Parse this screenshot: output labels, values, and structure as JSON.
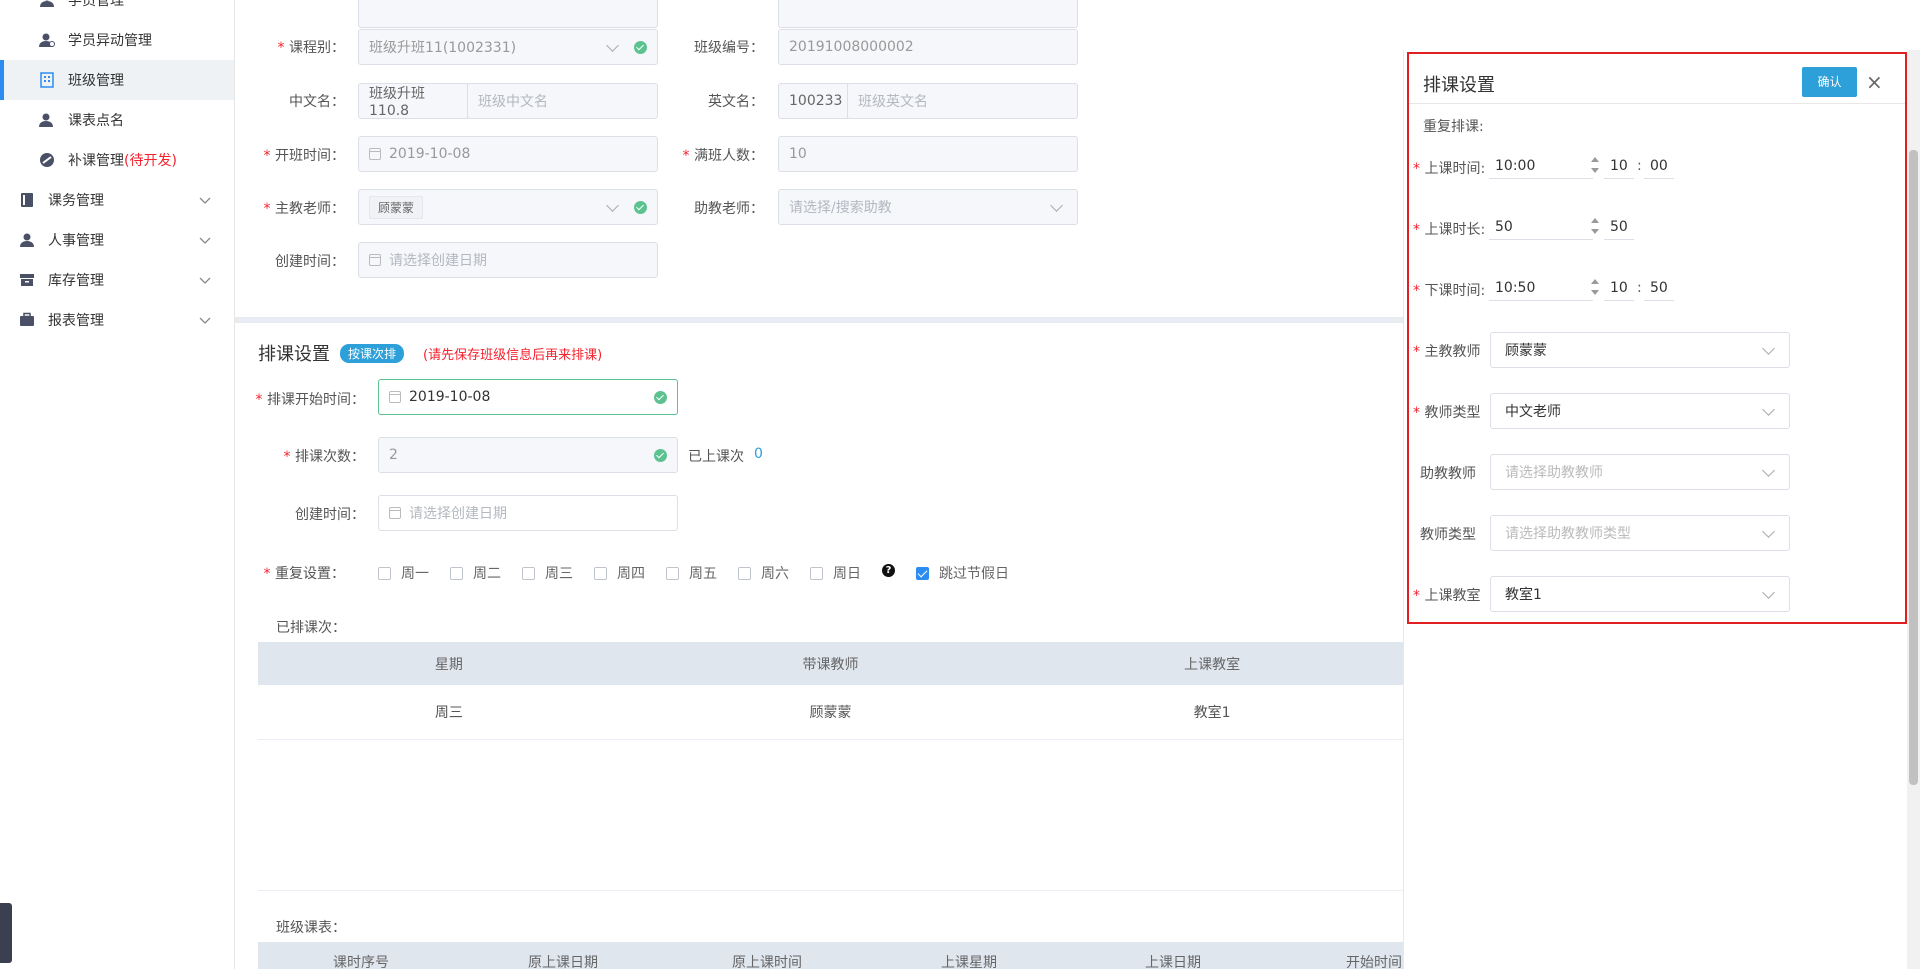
{
  "sidebar": {
    "items": [
      {
        "label": "学员管理"
      },
      {
        "label": "学员异动管理"
      },
      {
        "label": "班级管理"
      },
      {
        "label": "课表点名"
      },
      {
        "label": "补课管理",
        "note": "(待开发)"
      },
      {
        "label": "课务管理"
      },
      {
        "label": "人事管理"
      },
      {
        "label": "库存管理"
      },
      {
        "label": "报表管理"
      }
    ]
  },
  "form": {
    "course_label": "课程别：",
    "course_value": "班级升班11(1002331)",
    "class_no_label": "班级编号：",
    "class_no_value": "20191008000002",
    "cn_name_label": "中文名：",
    "cn_name_prefix": "班级升班110.8",
    "cn_name_placeholder": "班级中文名",
    "en_name_label": "英文名：",
    "en_name_prefix": "100233",
    "en_name_placeholder": "班级英文名",
    "open_time_label": "开班时间：",
    "open_time_value": "2019-10-08",
    "full_label": "满班人数：",
    "full_value": "10",
    "teacher_label": "主教老师：",
    "teacher_value": "顾蒙蒙",
    "assistant_label": "助教老师：",
    "assistant_placeholder": "请选择/搜索助教",
    "create_time_label": "创建时间：",
    "create_time_placeholder": "请选择创建日期"
  },
  "schedule": {
    "title": "排课设置",
    "badge": "按课次排",
    "warning": "(请先保存班级信息后再来排课)",
    "start_label": "排课开始时间：",
    "start_value": "2019-10-08",
    "count_label": "排课次数：",
    "count_value": "2",
    "done_label": "已上课次",
    "done_value": "0",
    "create_label": "创建时间：",
    "create_placeholder": "请选择创建日期",
    "repeat_label": "重复设置：",
    "weekdays": [
      "周一",
      "周二",
      "周三",
      "周四",
      "周五",
      "周六",
      "周日"
    ],
    "question_icon": "question-circle-icon",
    "skip_holiday": "跳过节假日",
    "done_list_label": "已排课次：",
    "table_headers": [
      "星期",
      "带课教师",
      "上课教室"
    ],
    "table_rows": [
      [
        "周三",
        "顾蒙蒙",
        "教室1"
      ]
    ],
    "class_table_label": "班级课表：",
    "class_table_headers": [
      "课时序号",
      "原上课日期",
      "原上课时间",
      "上课星期",
      "上课日期",
      "开始时间"
    ]
  },
  "panel": {
    "title": "排课设置",
    "confirm": "确认",
    "repeat_label": "重复排课:",
    "start_label": "上课时间:",
    "start_value": "10:00",
    "start_h": "10",
    "start_colon": ":",
    "start_m": "00",
    "duration_label": "上课时长:",
    "duration_value": "50",
    "duration_v2": "50",
    "end_label": "下课时间:",
    "end_value": "10:50",
    "end_h": "10",
    "end_colon": ":",
    "end_m": "50",
    "main_teacher_label": "主教教师",
    "main_teacher_value": "顾蒙蒙",
    "teacher_type_label": "教师类型",
    "teacher_type_value": "中文老师",
    "assistant_label": "助教教师",
    "assistant_placeholder": "请选择助教教师",
    "assistant_type_label": "教师类型",
    "assistant_type_placeholder": "请选择助教教师类型",
    "room_label": "上课教室",
    "room_value": "教室1"
  },
  "colors": {
    "accent": "#2d8cf0",
    "required": "#f5222d",
    "success": "#5cc290",
    "highlight_box": "#e02020"
  }
}
